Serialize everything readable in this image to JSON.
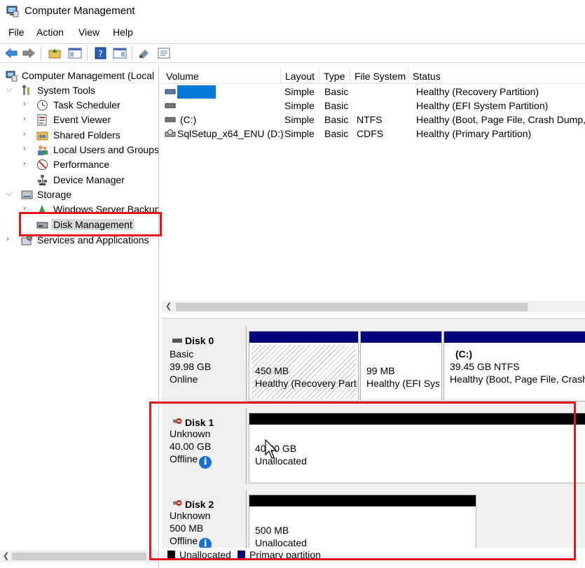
{
  "window": {
    "title": "Computer Management"
  },
  "menu": [
    "File",
    "Action",
    "View",
    "Help"
  ],
  "tree": {
    "root": "Computer Management (Local",
    "system_tools": "System Tools",
    "task_scheduler": "Task Scheduler",
    "event_viewer": "Event Viewer",
    "shared_folders": "Shared Folders",
    "local_users": "Local Users and Groups",
    "performance": "Performance",
    "device_manager": "Device Manager",
    "storage": "Storage",
    "wsb": "Windows Server Backup",
    "disk_management": "Disk Management",
    "services": "Services and Applications"
  },
  "volume_table": {
    "columns": [
      "Volume",
      "Layout",
      "Type",
      "File System",
      "Status"
    ],
    "rows": [
      {
        "volume": "",
        "layout": "Simple",
        "type": "Basic",
        "fs": "",
        "status": "Healthy (Recovery Partition)"
      },
      {
        "volume": "",
        "layout": "Simple",
        "type": "Basic",
        "fs": "",
        "status": "Healthy (EFI System Partition)"
      },
      {
        "volume": "(C:)",
        "layout": "Simple",
        "type": "Basic",
        "fs": "NTFS",
        "status": "Healthy (Boot, Page File, Crash Dump,"
      },
      {
        "volume": "SqlSetup_x64_ENU (D:)",
        "layout": "Simple",
        "type": "Basic",
        "fs": "CDFS",
        "status": "Healthy (Primary Partition)"
      }
    ]
  },
  "disks": [
    {
      "name": "Disk 0",
      "kind": "Basic",
      "size": "39.98 GB",
      "state": "Online",
      "partitions": [
        {
          "size": "450 MB",
          "desc": "Healthy (Recovery Partit"
        },
        {
          "size": "99 MB",
          "desc": "Healthy (EFI Syst"
        },
        {
          "label": "(C:)",
          "size": "39.45 GB NTFS",
          "desc": "Healthy (Boot, Page File, Crash"
        }
      ]
    },
    {
      "name": "Disk 1",
      "kind": "Unknown",
      "size": "40.00 GB",
      "state": "Offline",
      "partitions": [
        {
          "size": "40.00 GB",
          "desc": "Unallocated"
        }
      ]
    },
    {
      "name": "Disk 2",
      "kind": "Unknown",
      "size": "500 MB",
      "state": "Offline",
      "partitions": [
        {
          "size": "500 MB",
          "desc": "Unallocated"
        }
      ]
    }
  ],
  "legend": {
    "unallocated": "Unallocated",
    "primary": "Primary partition"
  },
  "colors": {
    "primary_bar": "#00007b",
    "unallocated_bar": "#000000",
    "highlight": "#e8141c",
    "selection_blue": "#0078d7"
  },
  "icons": {
    "info": "i"
  }
}
